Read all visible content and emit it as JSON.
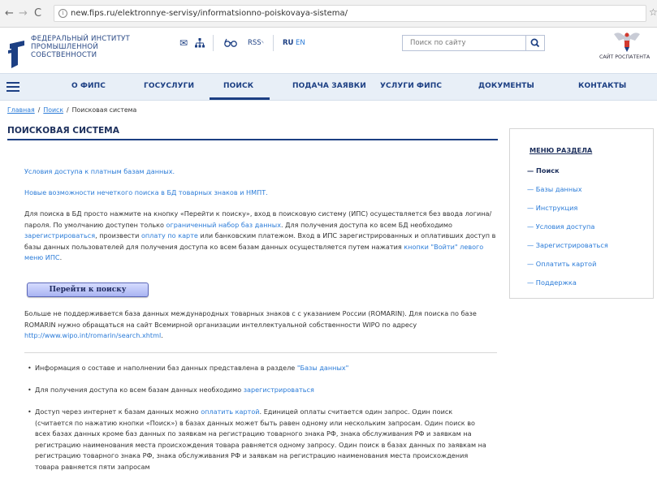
{
  "browser": {
    "url": "new.fips.ru/elektronnye-servisy/informatsionno-poiskovaya-sistema/"
  },
  "header": {
    "org_line1": "ФЕДЕРАЛЬНЫЙ ИНСТИТУТ",
    "org_line2": "ПРОМЫШЛЕННОЙ",
    "org_line3": "СОБСТВЕННОСТИ",
    "rss": "RSS",
    "lang_ru": "RU",
    "lang_en": "EN",
    "search_placeholder": "Поиск по сайту",
    "rospatent_caption": "САЙТ РОСПАТЕНТА"
  },
  "nav": {
    "items": [
      "О ФИПС",
      "ГОСУСЛУГИ",
      "ПОИСК",
      "ПОДАЧА ЗАЯВКИ",
      "УСЛУГИ ФИПС",
      "ДОКУМЕНТЫ",
      "КОНТАКТЫ"
    ],
    "active": "ПОИСК"
  },
  "breadcrumb": {
    "home": "Главная",
    "search": "Поиск",
    "current": "Поисковая система",
    "sep": "/"
  },
  "page": {
    "title": "ПОИСКОВАЯ СИСТЕМА",
    "link_paid": "Условия доступа к платным базам данных.",
    "link_fuzzy": "Новые возможности нечеткого поиска в БД товарных знаков и НМПТ.",
    "p1": {
      "t1": "Для поиска в БД просто нажмите на кнопку «Перейти к поиску», вход в поисковую систему (ИПС) осуществляется без ввода логина/пароля. По умолчанию доступен только ",
      "l1": "ограниченный набор баз данных",
      "t2": ". Для получения доступа ко всем БД необходимо ",
      "l2": "зарегистрироваться",
      "t3": ", произвести ",
      "l3": "оплату по карте",
      "t4": " или банковским платежом. Вход в ИПС зарегистрированных и оплативших доступ в базы данных пользователей для получения доступа ко всем базам данных осуществляется путем нажатия ",
      "l4": "кнопки \"Войти\" левого меню ИПС",
      "t5": "."
    },
    "go_button": "Перейти к поиску",
    "p2": {
      "t1": "Больше не поддерживается база данных международных товарных знаков с с указанием России (ROMARIN). Для поиска по базе ROMARIN нужно обращаться на сайт Всемирной организации интеллектуальной собственности WIPO по адресу ",
      "l1": "http://www.wipo.int/romarin/search.xhtml",
      "t2": "."
    },
    "bullets": [
      {
        "t1": "Информация о составе и наполнении баз данных представлена в разделе ",
        "l1": "\"Базы данных\"",
        "t2": ""
      },
      {
        "t1": "Для получения доступа ко всем базам данных необходимо ",
        "l1": "зарегистрироваться",
        "t2": ""
      },
      {
        "t1": "Доступ через интернет к базам данных можно ",
        "l1": "оплатить картой",
        "t2": ". Единицей оплаты считается один запрос. Один поиск (считается по нажатию кнопки «Поиск») в базах данных может быть равен одному или нескольким запросам. Один поиск во всех базах данных кроме баз данных по заявкам на регистрацию товарного знака РФ, знака обслуживания РФ и заявкам на регистрацию наименования места происхождения товара равняется одному запросу. Один поиск в базах данных по заявкам на регистрацию товарного знака РФ, знака обслуживания РФ и заявкам на регистрацию наименования места происхождения товара равняется пяти запросам"
      }
    ]
  },
  "side_menu": {
    "title": "МЕНЮ РАЗДЕЛА",
    "items": [
      "— Поиск",
      "— Базы данных",
      "— Инструкция",
      "— Условия доступа",
      "— Зарегистрироваться",
      "— Оплатить картой",
      "— Поддержка"
    ]
  },
  "colors": {
    "brand_dark": "#1c3f83",
    "link": "#2a7bd8",
    "nav_bg": "#e8eff7"
  }
}
